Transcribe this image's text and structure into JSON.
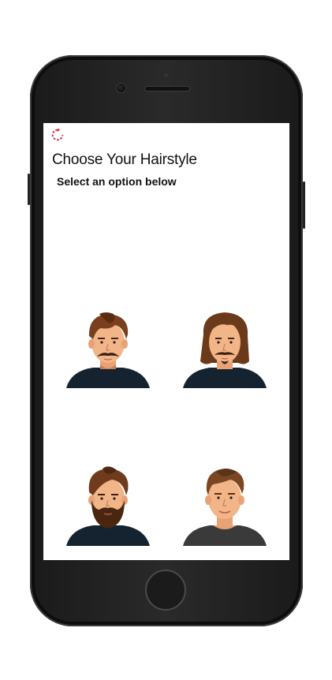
{
  "app": {
    "title": "Choose Your Hairstyle",
    "subtitle": "Select an option below",
    "accent_color": "#e0303c",
    "refresh_icon": "refresh-icon"
  },
  "hairstyles": [
    {
      "name": "short-fringe-mustache",
      "hair_color": "#7a3f1c",
      "facial_hair": "mustache",
      "shirt_color": "#15222f"
    },
    {
      "name": "long-hair-goatee",
      "hair_color": "#6b3a1a",
      "facial_hair": "goatee",
      "shirt_color": "#15222f"
    },
    {
      "name": "full-beard",
      "hair_color": "#6e3c1c",
      "facial_hair": "full-beard",
      "shirt_color": "#15222f"
    },
    {
      "name": "clean-shaven-short",
      "hair_color": "#7a4623",
      "facial_hair": "none",
      "shirt_color": "#3a3a3a"
    }
  ]
}
